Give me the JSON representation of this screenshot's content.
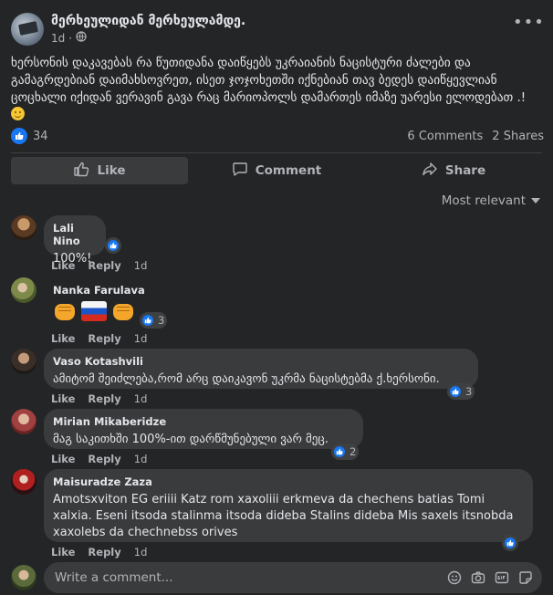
{
  "post": {
    "page_name": "მერხეულიდან მერხეულამდე.",
    "time": "1d",
    "text": "ხერსონის დაკავებას რა წუთიდანა დაიწყებს უკრაიანის ნაცისტური ძალები და გამაგრდებიან დაიმახსოვრეთ, ისეთ ჯოჯოხეთში იქნებიან თავ ბედეს დაიწყევლიან ცოცხალი იქიდან ვერავინ გავა რაც მარიოპოლს დამართეს იმაზე უარესი ელოდებათ .!",
    "reaction_count": "34",
    "comments_count": "6 Comments",
    "shares_count": "2 Shares"
  },
  "actions": {
    "like": "Like",
    "comment": "Comment",
    "share": "Share"
  },
  "sort_label": "Most relevant",
  "comment_actions": {
    "like": "Like",
    "reply": "Reply"
  },
  "comments": [
    {
      "author": "Lali Nino",
      "text": "100%!",
      "time": "1d",
      "reactions": ""
    },
    {
      "author": "Nanka Farulava",
      "text": "",
      "time": "1d",
      "reactions": "3"
    },
    {
      "author": "Vaso Kotashvili",
      "text": "ამიტომ შეიძლება,რომ არც დაიკავონ უკრმა ნაცისტებმა ქ.ხერსონი.",
      "time": "1d",
      "reactions": "3"
    },
    {
      "author": "Mirian Mikaberidze",
      "text": "მაგ საკითხში 100%-ით დარწმუნებული ვარ მეც.",
      "time": "1d",
      "reactions": "2"
    },
    {
      "author": "Maisuradze Zaza",
      "text": "Amotsxviton EG eriiii Katz rom xaxoliii erkmeva da chechens batias Tomi xalxia. Eseni itsoda stalinma itsoda dideba Stalins dideba Mis saxels itsnobda xaxolebs da chechnebss orives",
      "time": "1d",
      "reactions": ""
    }
  ],
  "composer": {
    "placeholder": "Write a comment..."
  },
  "colors": {
    "accent": "#1877f2",
    "card": "#242526",
    "bubble": "#3a3b3c",
    "muted": "#b0b3b8"
  },
  "icons": [
    "globe-icon",
    "more-icon",
    "like-icon",
    "comment-icon",
    "share-icon",
    "chevron-down-icon",
    "emoji-icon",
    "camera-icon",
    "gif-icon",
    "sticker-icon"
  ]
}
